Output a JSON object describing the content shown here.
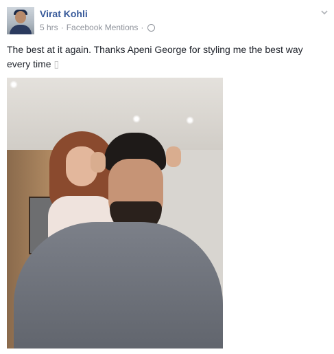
{
  "post": {
    "author": "Virat Kohli",
    "time": "5 hrs",
    "separator": "·",
    "source": "Facebook Mentions",
    "message": "The best at it again. Thanks Apeni George for styling me the best way every time",
    "trailing_glyph": "▯",
    "icons": {
      "privacy": "globe-icon",
      "options": "chevron-down-icon"
    }
  },
  "colors": {
    "author": "#365899",
    "meta": "#90949c",
    "text": "#1d2129"
  }
}
